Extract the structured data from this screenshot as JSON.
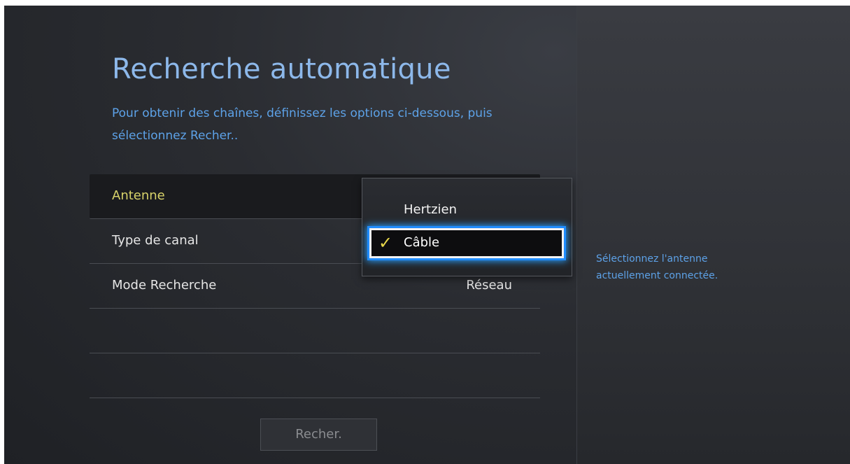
{
  "page": {
    "title": "Recherche automatique",
    "subtitle": "Pour obtenir des chaînes, définissez les options ci-dessous, puis sélectionnez Recher.."
  },
  "settings": [
    {
      "label": "Antenne",
      "value": ""
    },
    {
      "label": "Type de canal",
      "value": ""
    },
    {
      "label": "Mode Recherche",
      "value": "Réseau"
    }
  ],
  "dropdown": {
    "options": [
      {
        "label": "Hertzien",
        "selected": false
      },
      {
        "label": "Câble",
        "selected": true
      }
    ],
    "check_icon": "✓"
  },
  "help": {
    "line1": "Sélectionnez l'antenne",
    "line2": "actuellement connectée."
  },
  "actions": {
    "search_label": "Recher."
  },
  "colors": {
    "title": "#8db8ea",
    "accent_blue": "#5da2e8",
    "focus_yellow": "#d8d36a",
    "highlight_glow": "#1f8cff"
  }
}
